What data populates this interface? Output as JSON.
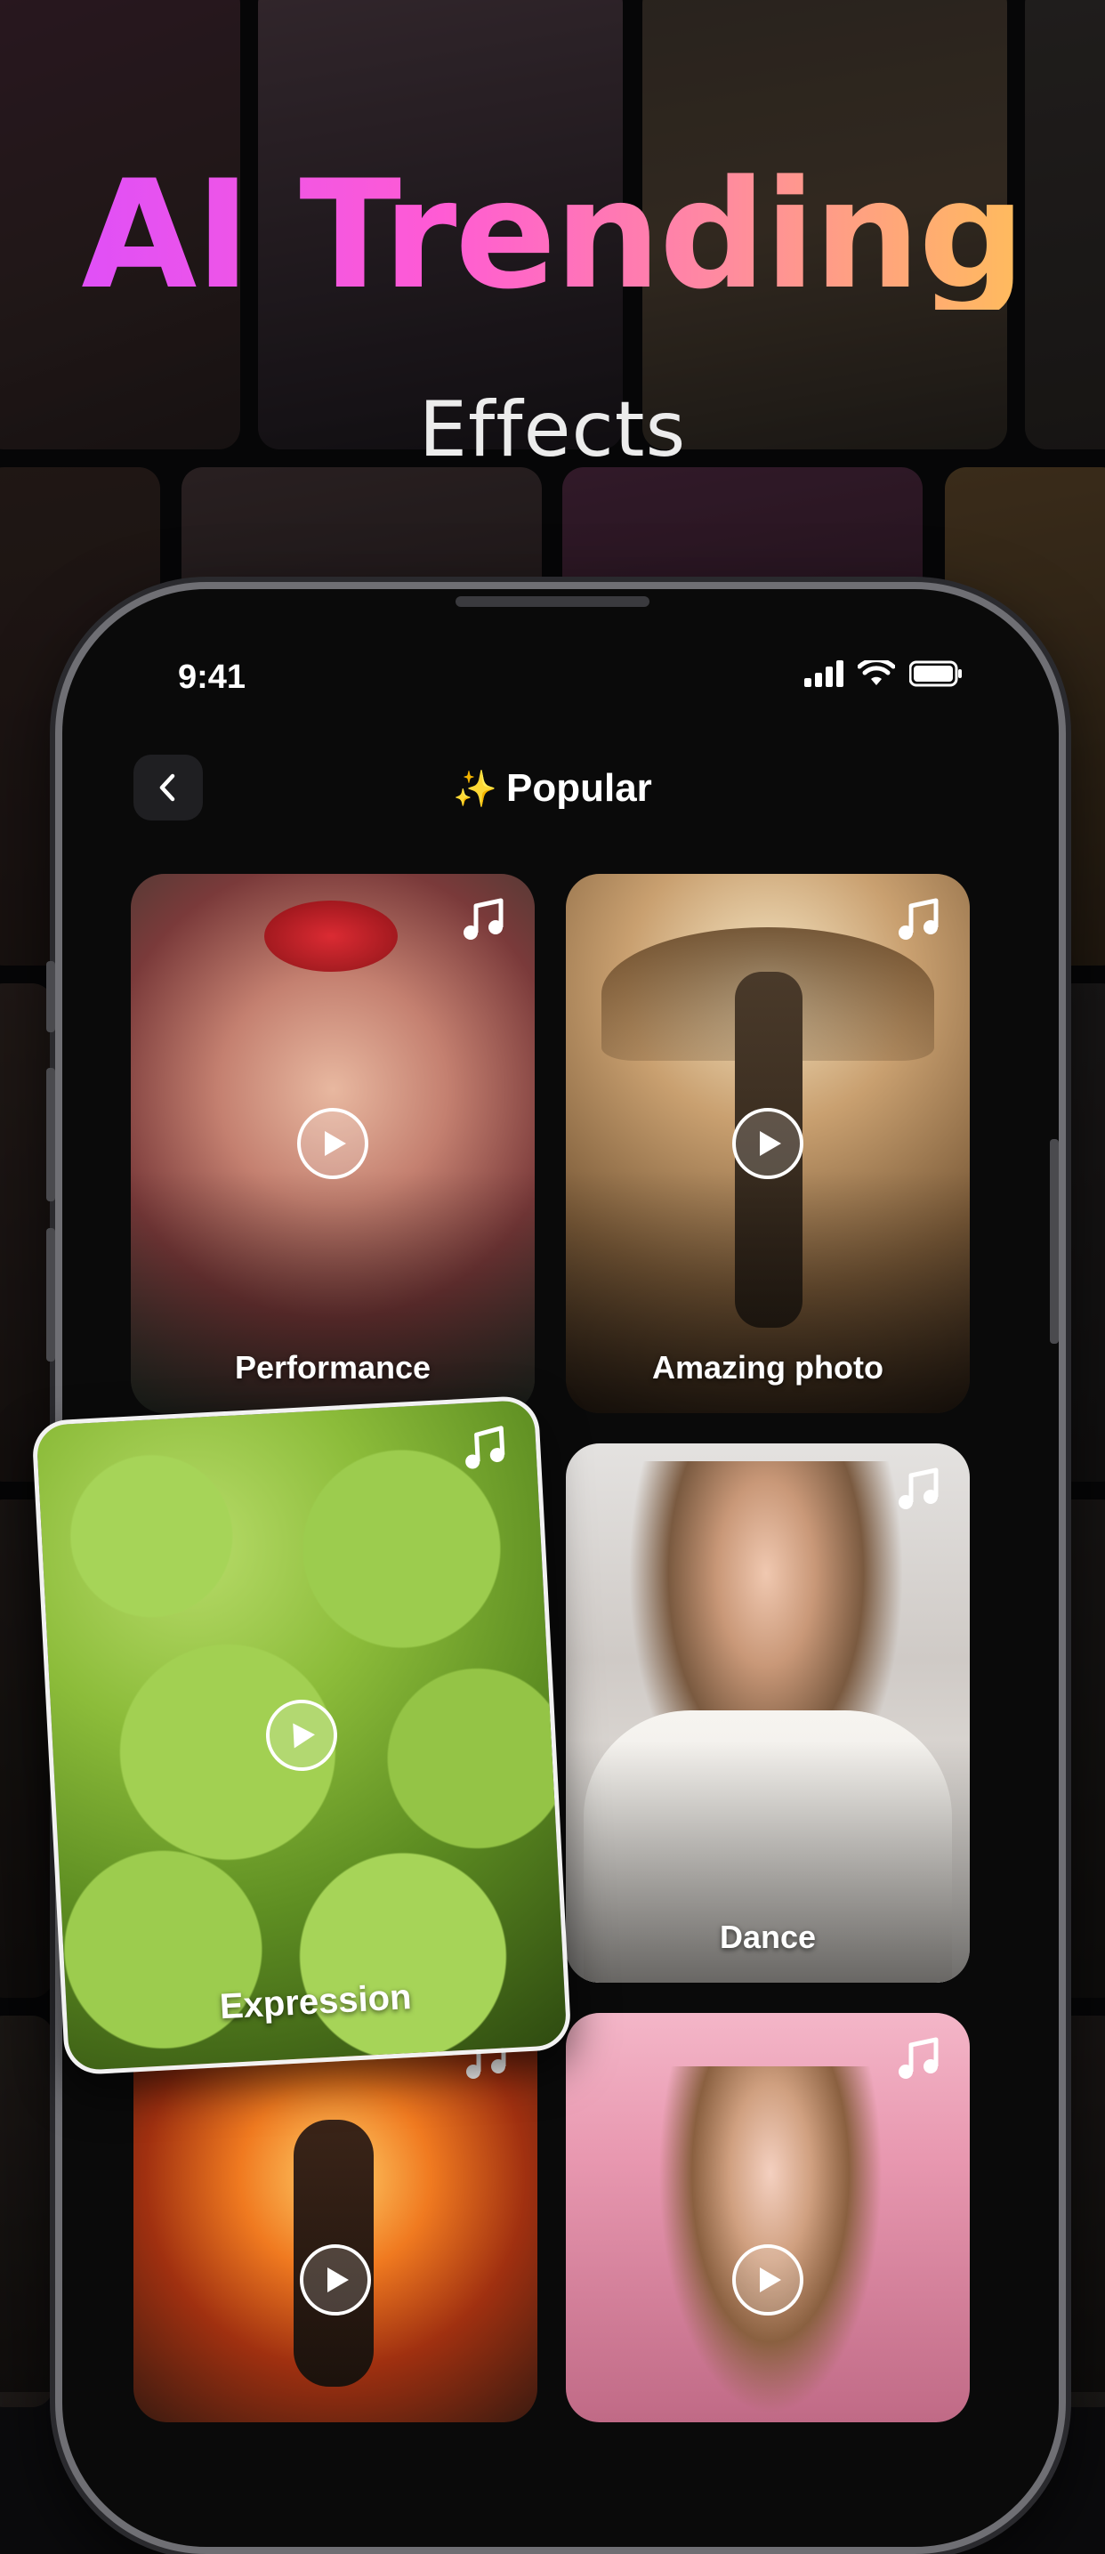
{
  "promo": {
    "headline": "AI Trending",
    "subheadline": "Effects"
  },
  "status_bar": {
    "time": "9:41"
  },
  "nav": {
    "back_icon": "chevron-left-icon",
    "title": "Popular",
    "title_icon": "sparkles-icon"
  },
  "cards": [
    {
      "label": "Performance",
      "has_music": true
    },
    {
      "label": "Amazing photo",
      "has_music": true
    },
    {
      "label": "Expression",
      "has_music": true
    },
    {
      "label": "Dance",
      "has_music": true
    },
    {
      "label": "",
      "has_music": true
    },
    {
      "label": "",
      "has_music": true
    }
  ],
  "colors": {
    "headline_gradient": [
      "#d94dff",
      "#ff5bd4",
      "#ffc94a"
    ],
    "background": "#0b0b0d",
    "phone_screen": "#0a0a0a",
    "sparkle": "#ffd54a"
  }
}
